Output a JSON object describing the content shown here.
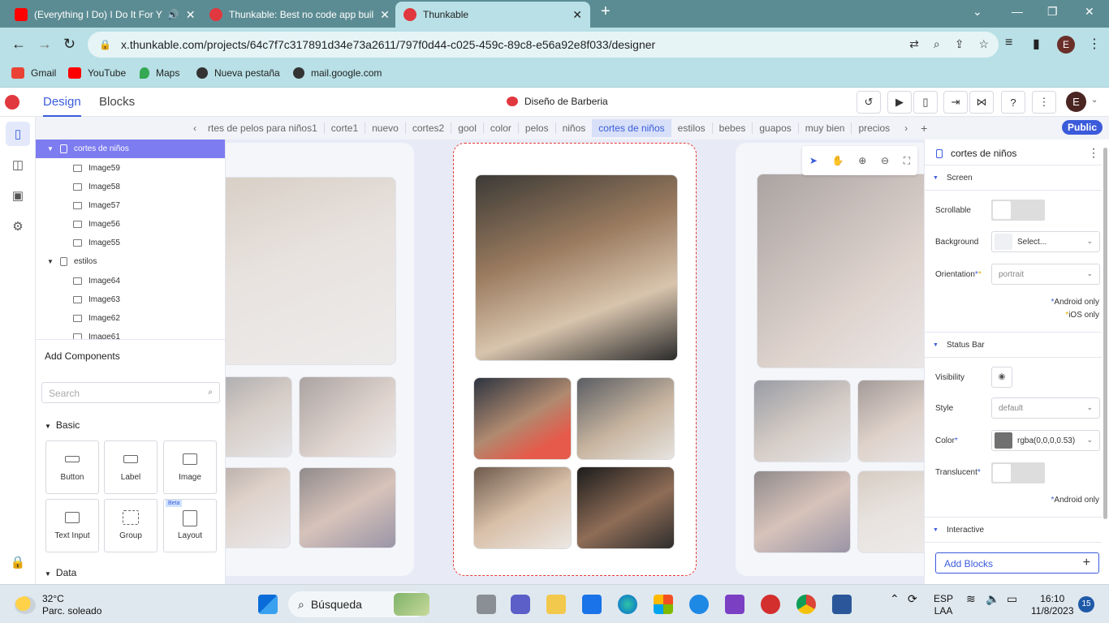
{
  "browser": {
    "tabs": [
      {
        "title": "(Everything I Do) I Do It For Y",
        "favicon_color": "#ff0000"
      },
      {
        "title": "Thunkable: Best no code app buil",
        "favicon_color": "#e0383e"
      },
      {
        "title": "Thunkable",
        "favicon_color": "#e0383e"
      }
    ],
    "url": "x.thunkable.com/projects/64c7f7c317891d34e73a2611/797f0d44-c025-459c-89c8-e56a92e8f033/designer",
    "profile_initial": "E",
    "bookmarks": [
      {
        "label": "Gmail",
        "icon": "gmail-icon",
        "color": "#ea4335"
      },
      {
        "label": "YouTube",
        "icon": "youtube-icon",
        "color": "#ff0000"
      },
      {
        "label": "Maps",
        "icon": "maps-icon",
        "color": "#34a853"
      },
      {
        "label": "Nueva pestaña",
        "icon": "globe-icon",
        "color": "#333333"
      },
      {
        "label": "mail.google.com",
        "icon": "globe-icon",
        "color": "#333333"
      }
    ]
  },
  "app": {
    "tabs": {
      "design": "Design",
      "blocks": "Blocks"
    },
    "project_name": "Diseño de Barberia",
    "user_initial": "E",
    "accent": "#3b5bdb",
    "public_label": "Public"
  },
  "screens": [
    "rtes de pelos para niños1",
    "corte1",
    "nuevo",
    "cortes2",
    "gool",
    "color",
    "pelos",
    "niños",
    "cortes de niños",
    "estilos",
    "bebes",
    "guapos",
    "muy bien",
    "precios"
  ],
  "active_screen": "cortes de niños",
  "tree": [
    {
      "label": "cortes de niños",
      "kind": "screen",
      "selected": true
    },
    {
      "label": "Image59",
      "kind": "image"
    },
    {
      "label": "Image58",
      "kind": "image"
    },
    {
      "label": "Image57",
      "kind": "image"
    },
    {
      "label": "Image56",
      "kind": "image"
    },
    {
      "label": "Image55",
      "kind": "image"
    },
    {
      "label": "estilos",
      "kind": "screen"
    },
    {
      "label": "Image64",
      "kind": "image"
    },
    {
      "label": "Image63",
      "kind": "image"
    },
    {
      "label": "Image62",
      "kind": "image"
    },
    {
      "label": "Image61",
      "kind": "image"
    }
  ],
  "add_components": {
    "title": "Add Components",
    "search_placeholder": "Search",
    "basic_label": "Basic",
    "data_label": "Data",
    "items": [
      {
        "label": "Button",
        "icon": "button-icon"
      },
      {
        "label": "Label",
        "icon": "label-icon"
      },
      {
        "label": "Image",
        "icon": "image-icon"
      },
      {
        "label": "Text Input",
        "icon": "text-input-icon"
      },
      {
        "label": "Group",
        "icon": "group-icon"
      },
      {
        "label": "Layout",
        "icon": "layout-icon",
        "badge": "Beta"
      }
    ]
  },
  "properties": {
    "title": "cortes de niños",
    "screen_group": "Screen",
    "scrollable_label": "Scrollable",
    "background_label": "Background",
    "background_value": "Select...",
    "orientation_label": "Orientation",
    "orientation_value": "portrait",
    "android_only": "Android only",
    "ios_only": "iOS only",
    "statusbar_group": "Status Bar",
    "visibility_label": "Visibility",
    "style_label": "Style",
    "style_value": "default",
    "color_label": "Color",
    "color_value": "rgba(0,0,0,0.53)",
    "color_swatch": "#707070",
    "translucent_label": "Translucent",
    "android_only_2": "Android only",
    "interactive_group": "Interactive",
    "add_blocks": "Add Blocks"
  },
  "taskbar": {
    "temp": "32°C",
    "weather": "Parc. soleado",
    "search": "Búsqueda",
    "lang": "ESP",
    "layout": "LAA",
    "time": "16:10",
    "date": "11/8/2023",
    "notifications": "15"
  }
}
